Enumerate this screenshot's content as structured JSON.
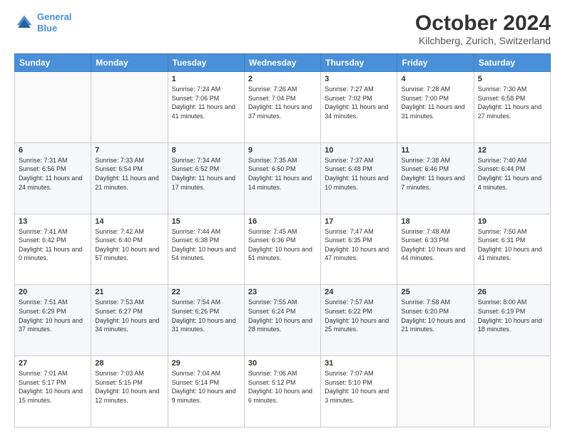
{
  "logo": {
    "line1": "General",
    "line2": "Blue"
  },
  "title": "October 2024",
  "subtitle": "Kilchberg, Zurich, Switzerland",
  "days_of_week": [
    "Sunday",
    "Monday",
    "Tuesday",
    "Wednesday",
    "Thursday",
    "Friday",
    "Saturday"
  ],
  "weeks": [
    [
      {
        "day": "",
        "sunrise": "",
        "sunset": "",
        "daylight": ""
      },
      {
        "day": "",
        "sunrise": "",
        "sunset": "",
        "daylight": ""
      },
      {
        "day": "1",
        "sunrise": "Sunrise: 7:24 AM",
        "sunset": "Sunset: 7:06 PM",
        "daylight": "Daylight: 11 hours and 41 minutes."
      },
      {
        "day": "2",
        "sunrise": "Sunrise: 7:26 AM",
        "sunset": "Sunset: 7:04 PM",
        "daylight": "Daylight: 11 hours and 37 minutes."
      },
      {
        "day": "3",
        "sunrise": "Sunrise: 7:27 AM",
        "sunset": "Sunset: 7:02 PM",
        "daylight": "Daylight: 11 hours and 34 minutes."
      },
      {
        "day": "4",
        "sunrise": "Sunrise: 7:28 AM",
        "sunset": "Sunset: 7:00 PM",
        "daylight": "Daylight: 11 hours and 31 minutes."
      },
      {
        "day": "5",
        "sunrise": "Sunrise: 7:30 AM",
        "sunset": "Sunset: 6:58 PM",
        "daylight": "Daylight: 11 hours and 27 minutes."
      }
    ],
    [
      {
        "day": "6",
        "sunrise": "Sunrise: 7:31 AM",
        "sunset": "Sunset: 6:56 PM",
        "daylight": "Daylight: 11 hours and 24 minutes."
      },
      {
        "day": "7",
        "sunrise": "Sunrise: 7:33 AM",
        "sunset": "Sunset: 6:54 PM",
        "daylight": "Daylight: 11 hours and 21 minutes."
      },
      {
        "day": "8",
        "sunrise": "Sunrise: 7:34 AM",
        "sunset": "Sunset: 6:52 PM",
        "daylight": "Daylight: 11 hours and 17 minutes."
      },
      {
        "day": "9",
        "sunrise": "Sunrise: 7:35 AM",
        "sunset": "Sunset: 6:50 PM",
        "daylight": "Daylight: 11 hours and 14 minutes."
      },
      {
        "day": "10",
        "sunrise": "Sunrise: 7:37 AM",
        "sunset": "Sunset: 6:48 PM",
        "daylight": "Daylight: 11 hours and 10 minutes."
      },
      {
        "day": "11",
        "sunrise": "Sunrise: 7:38 AM",
        "sunset": "Sunset: 6:46 PM",
        "daylight": "Daylight: 11 hours and 7 minutes."
      },
      {
        "day": "12",
        "sunrise": "Sunrise: 7:40 AM",
        "sunset": "Sunset: 6:44 PM",
        "daylight": "Daylight: 11 hours and 4 minutes."
      }
    ],
    [
      {
        "day": "13",
        "sunrise": "Sunrise: 7:41 AM",
        "sunset": "Sunset: 6:42 PM",
        "daylight": "Daylight: 11 hours and 0 minutes."
      },
      {
        "day": "14",
        "sunrise": "Sunrise: 7:42 AM",
        "sunset": "Sunset: 6:40 PM",
        "daylight": "Daylight: 10 hours and 57 minutes."
      },
      {
        "day": "15",
        "sunrise": "Sunrise: 7:44 AM",
        "sunset": "Sunset: 6:38 PM",
        "daylight": "Daylight: 10 hours and 54 minutes."
      },
      {
        "day": "16",
        "sunrise": "Sunrise: 7:45 AM",
        "sunset": "Sunset: 6:36 PM",
        "daylight": "Daylight: 10 hours and 51 minutes."
      },
      {
        "day": "17",
        "sunrise": "Sunrise: 7:47 AM",
        "sunset": "Sunset: 6:35 PM",
        "daylight": "Daylight: 10 hours and 47 minutes."
      },
      {
        "day": "18",
        "sunrise": "Sunrise: 7:48 AM",
        "sunset": "Sunset: 6:33 PM",
        "daylight": "Daylight: 10 hours and 44 minutes."
      },
      {
        "day": "19",
        "sunrise": "Sunrise: 7:50 AM",
        "sunset": "Sunset: 6:31 PM",
        "daylight": "Daylight: 10 hours and 41 minutes."
      }
    ],
    [
      {
        "day": "20",
        "sunrise": "Sunrise: 7:51 AM",
        "sunset": "Sunset: 6:29 PM",
        "daylight": "Daylight: 10 hours and 37 minutes."
      },
      {
        "day": "21",
        "sunrise": "Sunrise: 7:53 AM",
        "sunset": "Sunset: 6:27 PM",
        "daylight": "Daylight: 10 hours and 34 minutes."
      },
      {
        "day": "22",
        "sunrise": "Sunrise: 7:54 AM",
        "sunset": "Sunset: 6:26 PM",
        "daylight": "Daylight: 10 hours and 31 minutes."
      },
      {
        "day": "23",
        "sunrise": "Sunrise: 7:55 AM",
        "sunset": "Sunset: 6:24 PM",
        "daylight": "Daylight: 10 hours and 28 minutes."
      },
      {
        "day": "24",
        "sunrise": "Sunrise: 7:57 AM",
        "sunset": "Sunset: 6:22 PM",
        "daylight": "Daylight: 10 hours and 25 minutes."
      },
      {
        "day": "25",
        "sunrise": "Sunrise: 7:58 AM",
        "sunset": "Sunset: 6:20 PM",
        "daylight": "Daylight: 10 hours and 21 minutes."
      },
      {
        "day": "26",
        "sunrise": "Sunrise: 8:00 AM",
        "sunset": "Sunset: 6:19 PM",
        "daylight": "Daylight: 10 hours and 18 minutes."
      }
    ],
    [
      {
        "day": "27",
        "sunrise": "Sunrise: 7:01 AM",
        "sunset": "Sunset: 5:17 PM",
        "daylight": "Daylight: 10 hours and 15 minutes."
      },
      {
        "day": "28",
        "sunrise": "Sunrise: 7:03 AM",
        "sunset": "Sunset: 5:15 PM",
        "daylight": "Daylight: 10 hours and 12 minutes."
      },
      {
        "day": "29",
        "sunrise": "Sunrise: 7:04 AM",
        "sunset": "Sunset: 5:14 PM",
        "daylight": "Daylight: 10 hours and 9 minutes."
      },
      {
        "day": "30",
        "sunrise": "Sunrise: 7:06 AM",
        "sunset": "Sunset: 5:12 PM",
        "daylight": "Daylight: 10 hours and 6 minutes."
      },
      {
        "day": "31",
        "sunrise": "Sunrise: 7:07 AM",
        "sunset": "Sunset: 5:10 PM",
        "daylight": "Daylight: 10 hours and 3 minutes."
      },
      {
        "day": "",
        "sunrise": "",
        "sunset": "",
        "daylight": ""
      },
      {
        "day": "",
        "sunrise": "",
        "sunset": "",
        "daylight": ""
      }
    ]
  ]
}
